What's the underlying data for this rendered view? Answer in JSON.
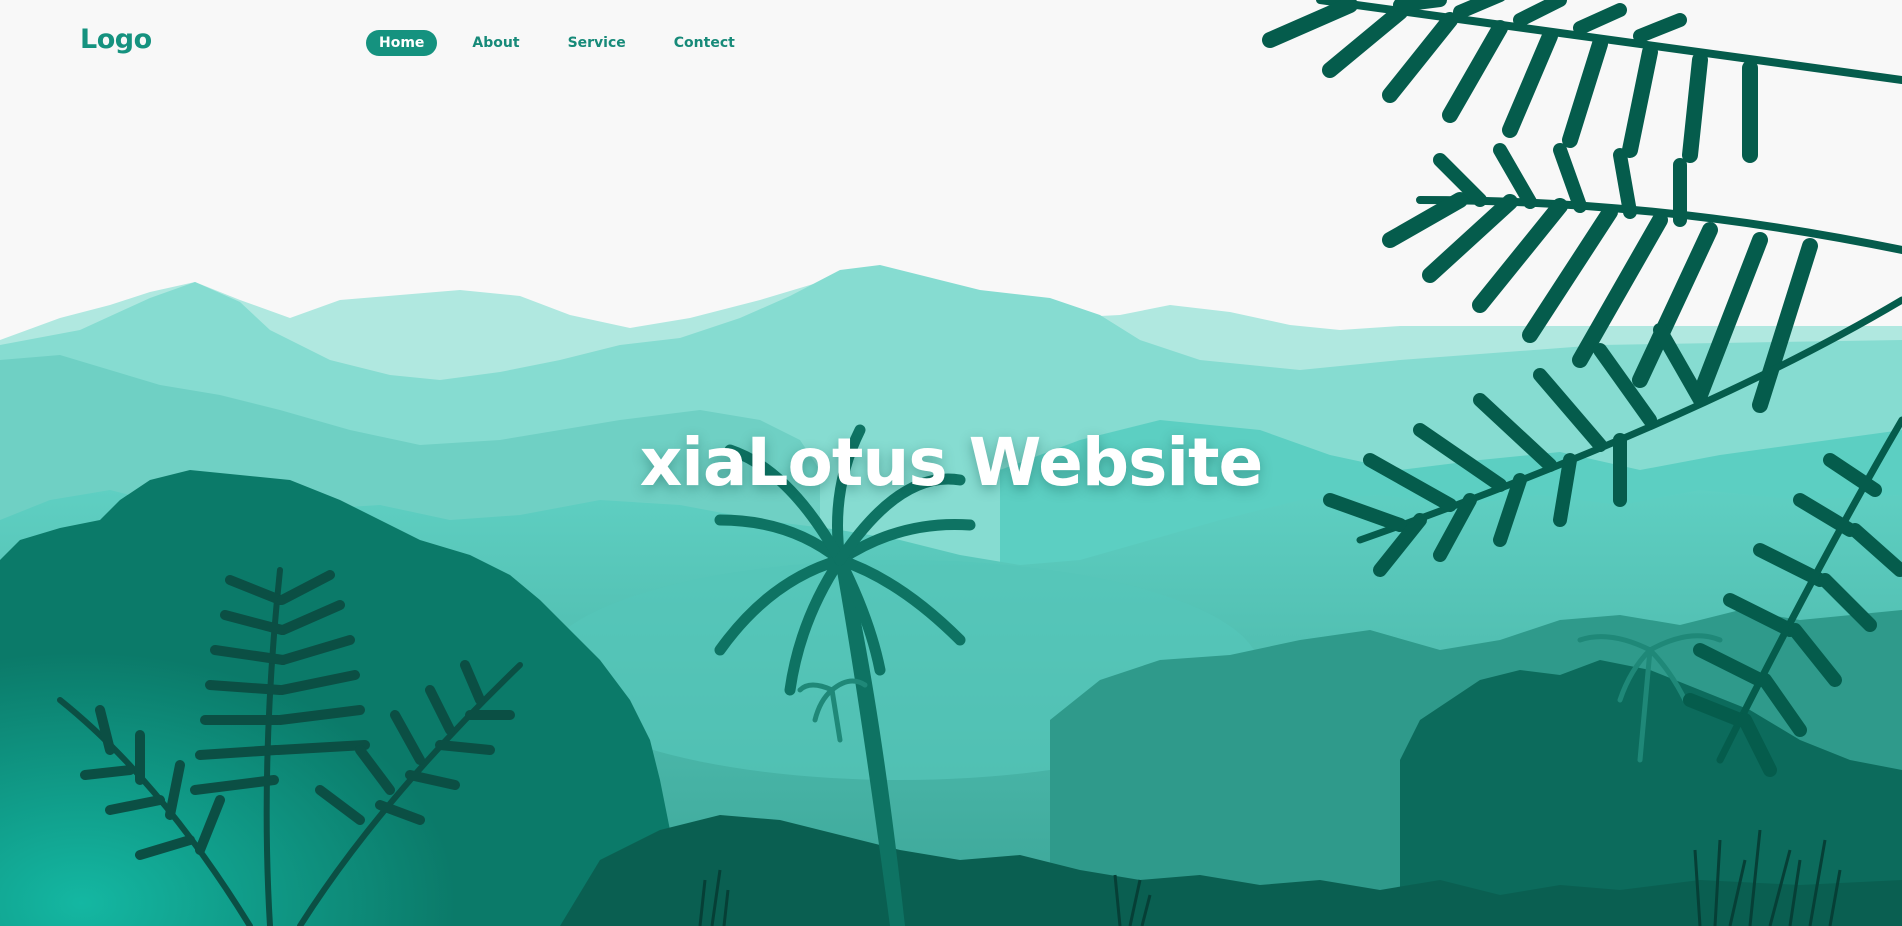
{
  "header": {
    "logo": "Logo",
    "nav": [
      {
        "label": "Home",
        "active": true
      },
      {
        "label": "About",
        "active": false
      },
      {
        "label": "Service",
        "active": false
      },
      {
        "label": "Contect",
        "active": false
      }
    ]
  },
  "hero": {
    "title": "xiaLotus Website"
  },
  "colors": {
    "accent": "#15927f",
    "background": "#f8f8f8",
    "sky_mountains": "#b0e8e0",
    "mid_mountains": "#86dcd1",
    "forest": "#3aa496",
    "deep_forest": "#0c6b5c",
    "foliage": "#055c4c",
    "hero_text": "#ffffff"
  },
  "icons": [
    "fern-leaf-icon",
    "palm-tree-icon"
  ]
}
